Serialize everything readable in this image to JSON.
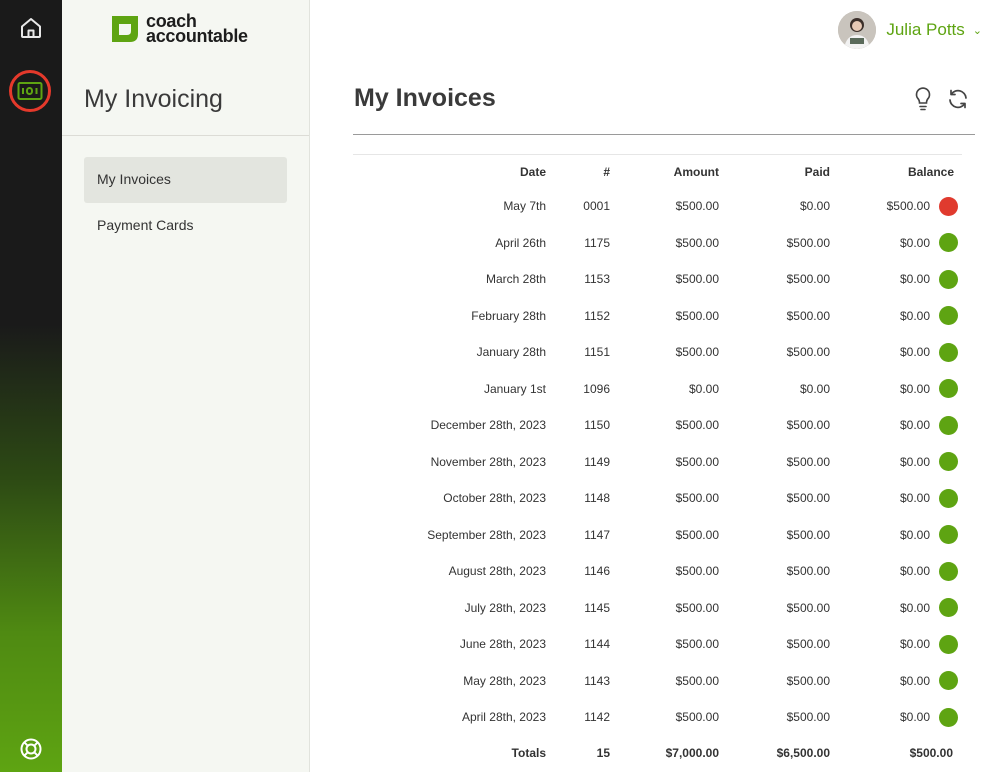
{
  "brand": {
    "line1": "coach",
    "line2": "accountable",
    "color": "#5ea412"
  },
  "rail": {
    "items": [
      {
        "name": "home-icon"
      },
      {
        "name": "invoice-icon",
        "active": true
      },
      {
        "name": "help-lifebuoy-icon"
      }
    ]
  },
  "sidebar": {
    "title": "My Invoicing",
    "items": [
      {
        "label": "My Invoices",
        "active": true
      },
      {
        "label": "Payment Cards",
        "active": false
      }
    ]
  },
  "user": {
    "name": "Julia Potts",
    "chevron": "⌄"
  },
  "main": {
    "title": "My Invoices",
    "tools": [
      "lightbulb-icon",
      "refresh-icon"
    ]
  },
  "table": {
    "headers": {
      "date": "Date",
      "num": "#",
      "amount": "Amount",
      "paid": "Paid",
      "balance": "Balance"
    },
    "rows": [
      {
        "date": "May 7th",
        "num": "0001",
        "amount": "$500.00",
        "paid": "$0.00",
        "balance": "$500.00",
        "status": "unpaid"
      },
      {
        "date": "April 26th",
        "num": "1175",
        "amount": "$500.00",
        "paid": "$500.00",
        "balance": "$0.00",
        "status": "paid"
      },
      {
        "date": "March 28th",
        "num": "1153",
        "amount": "$500.00",
        "paid": "$500.00",
        "balance": "$0.00",
        "status": "paid"
      },
      {
        "date": "February 28th",
        "num": "1152",
        "amount": "$500.00",
        "paid": "$500.00",
        "balance": "$0.00",
        "status": "paid"
      },
      {
        "date": "January 28th",
        "num": "1151",
        "amount": "$500.00",
        "paid": "$500.00",
        "balance": "$0.00",
        "status": "paid"
      },
      {
        "date": "January 1st",
        "num": "1096",
        "amount": "$0.00",
        "paid": "$0.00",
        "balance": "$0.00",
        "status": "paid"
      },
      {
        "date": "December 28th, 2023",
        "num": "1150",
        "amount": "$500.00",
        "paid": "$500.00",
        "balance": "$0.00",
        "status": "paid"
      },
      {
        "date": "November 28th, 2023",
        "num": "1149",
        "amount": "$500.00",
        "paid": "$500.00",
        "balance": "$0.00",
        "status": "paid"
      },
      {
        "date": "October 28th, 2023",
        "num": "1148",
        "amount": "$500.00",
        "paid": "$500.00",
        "balance": "$0.00",
        "status": "paid"
      },
      {
        "date": "September 28th, 2023",
        "num": "1147",
        "amount": "$500.00",
        "paid": "$500.00",
        "balance": "$0.00",
        "status": "paid"
      },
      {
        "date": "August 28th, 2023",
        "num": "1146",
        "amount": "$500.00",
        "paid": "$500.00",
        "balance": "$0.00",
        "status": "paid"
      },
      {
        "date": "July 28th, 2023",
        "num": "1145",
        "amount": "$500.00",
        "paid": "$500.00",
        "balance": "$0.00",
        "status": "paid"
      },
      {
        "date": "June 28th, 2023",
        "num": "1144",
        "amount": "$500.00",
        "paid": "$500.00",
        "balance": "$0.00",
        "status": "paid"
      },
      {
        "date": "May 28th, 2023",
        "num": "1143",
        "amount": "$500.00",
        "paid": "$500.00",
        "balance": "$0.00",
        "status": "paid"
      },
      {
        "date": "April 28th, 2023",
        "num": "1142",
        "amount": "$500.00",
        "paid": "$500.00",
        "balance": "$0.00",
        "status": "paid"
      }
    ],
    "totals": {
      "label": "Totals",
      "count": "15",
      "amount": "$7,000.00",
      "paid": "$6,500.00",
      "balance": "$500.00"
    }
  },
  "colors": {
    "paid": "#5ea412",
    "unpaid": "#e03a2e",
    "accent": "#5ea412"
  }
}
